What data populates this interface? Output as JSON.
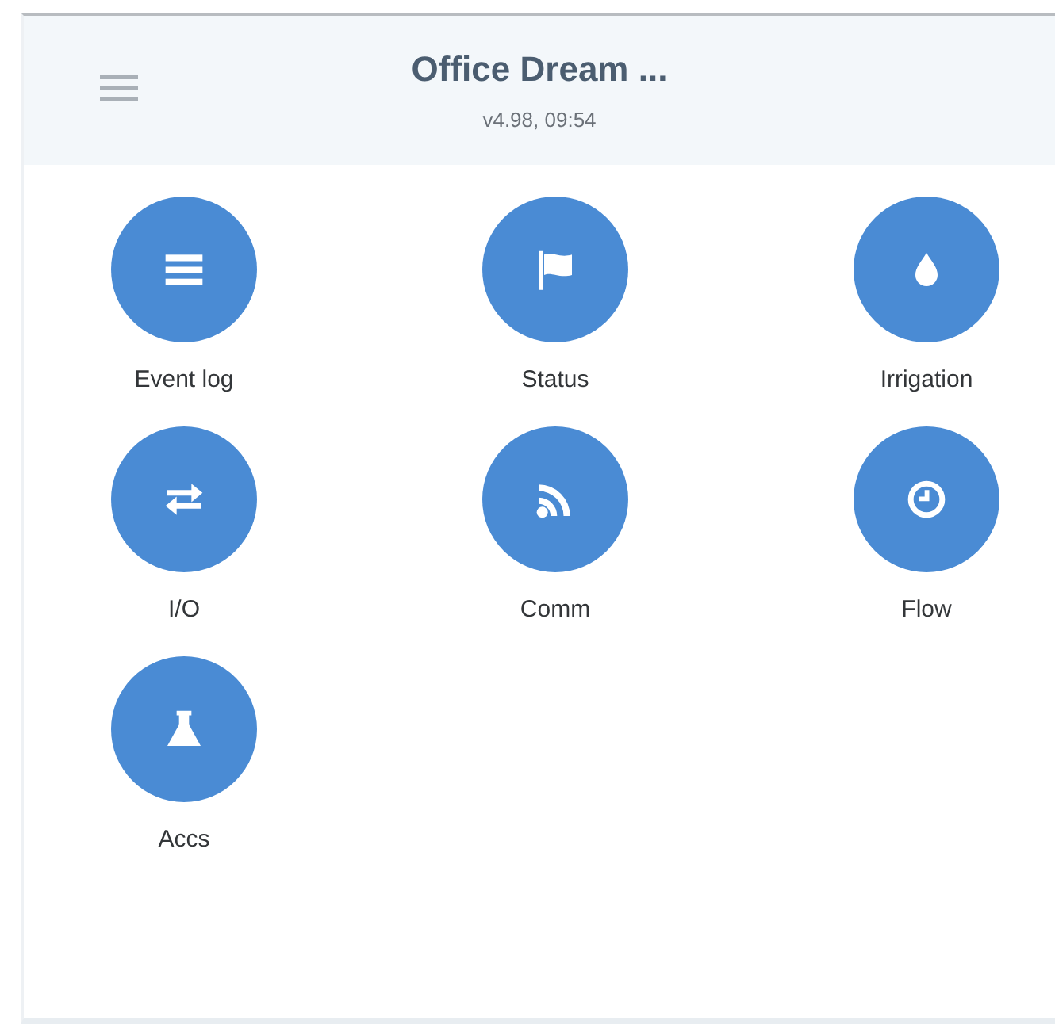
{
  "header": {
    "title": "Office Dream ...",
    "subtitle": "v4.98, 09:54"
  },
  "tiles": [
    {
      "label": "Event log"
    },
    {
      "label": "Status"
    },
    {
      "label": "Irrigation"
    },
    {
      "label": "I/O"
    },
    {
      "label": "Comm"
    },
    {
      "label": "Flow"
    },
    {
      "label": "Accs"
    }
  ]
}
